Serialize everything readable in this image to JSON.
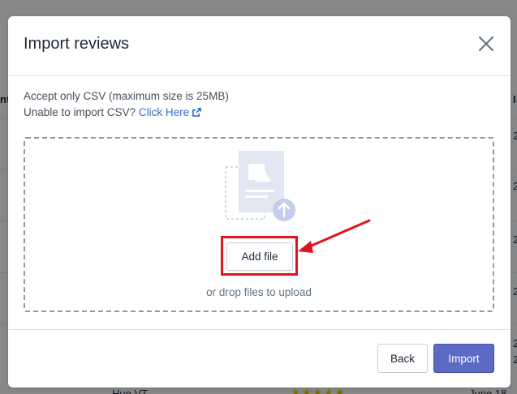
{
  "modal": {
    "title": "Import reviews",
    "info_line_1": "Accept only CSV (maximum size is 25MB)",
    "info_line_2_prefix": "Unable to import CSV?",
    "info_link": "Click Here",
    "dropzone": {
      "add_file_label": "Add file",
      "drop_hint": "or drop files to upload"
    },
    "footer": {
      "back_label": "Back",
      "import_label": "Import"
    }
  },
  "background": {
    "partial_texts": [
      "nt",
      "I",
      "2",
      "2",
      "2",
      "2",
      "2",
      "2"
    ],
    "bottom_row_name": "Hue VT",
    "bottom_row_date": "June 18",
    "stars": "★★★★★"
  },
  "colors": {
    "primary": "#5c6ac4",
    "link": "#2c6ecb",
    "annotation": "#e0141e"
  },
  "icons": {
    "close": "close-icon",
    "external_link": "external-link-icon",
    "upload_illustration": "upload-file-illustration"
  }
}
